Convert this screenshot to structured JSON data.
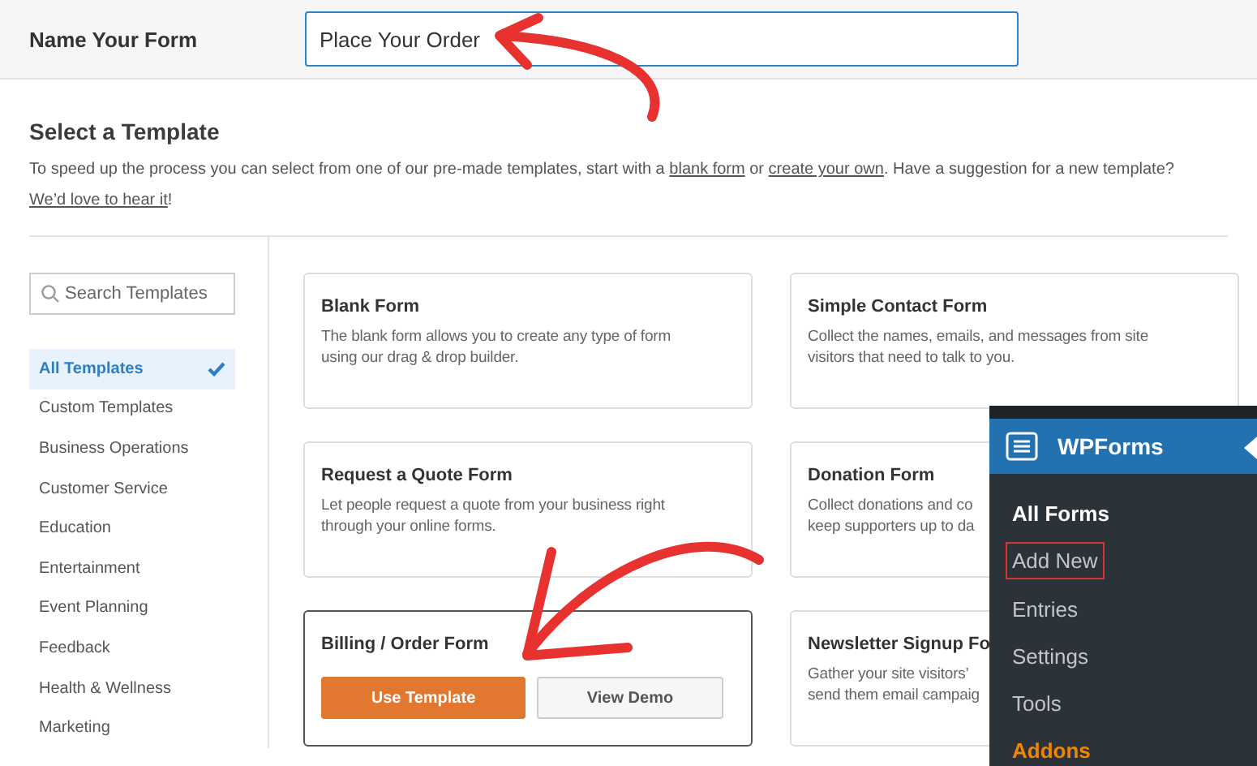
{
  "name_form": {
    "label": "Name Your Form",
    "value": "Place Your Order"
  },
  "section": {
    "title": "Select a Template",
    "intro": [
      {
        "kind": "text",
        "text": "To speed up the process you can select from one of our pre-made templates, start with a "
      },
      {
        "kind": "link",
        "text": "blank form"
      },
      {
        "kind": "text",
        "text": " or "
      },
      {
        "kind": "link",
        "text": "create your own"
      },
      {
        "kind": "text",
        "text": ". Have a suggestion for a new template? "
      },
      {
        "kind": "link",
        "text": "We’d love to hear it"
      },
      {
        "kind": "text",
        "text": "!"
      }
    ]
  },
  "search": {
    "placeholder": "Search Templates"
  },
  "categories": [
    {
      "label": "All Templates",
      "selected": true
    },
    {
      "label": "Custom Templates",
      "selected": false
    },
    {
      "label": "Business Operations",
      "selected": false
    },
    {
      "label": "Customer Service",
      "selected": false
    },
    {
      "label": "Education",
      "selected": false
    },
    {
      "label": "Entertainment",
      "selected": false
    },
    {
      "label": "Event Planning",
      "selected": false
    },
    {
      "label": "Feedback",
      "selected": false
    },
    {
      "label": "Health & Wellness",
      "selected": false
    },
    {
      "label": "Marketing",
      "selected": false
    }
  ],
  "templates": [
    {
      "title": "Blank Form",
      "description": [
        "The blank form allows you to create any type of form",
        "using our drag & drop builder."
      ],
      "selected": false
    },
    {
      "title": "Simple Contact Form",
      "description": [
        "Collect the names, emails, and messages from site",
        "visitors that need to talk to you."
      ],
      "selected": false
    },
    {
      "title": "Request a Quote Form",
      "description": [
        "Let people request a quote from your business right",
        "through your online forms."
      ],
      "selected": false
    },
    {
      "title": "Donation Form",
      "description": [
        "Collect donations and co",
        "keep supporters up to da"
      ],
      "selected": false
    },
    {
      "title": "Billing / Order Form",
      "selected": true,
      "buttons": [
        {
          "label": "Use Template",
          "kind": "primary"
        },
        {
          "label": "View Demo",
          "kind": "secondary"
        }
      ]
    },
    {
      "title": "Newsletter Signup Fo",
      "description": [
        "Gather your site visitors’",
        "send them email campaig"
      ],
      "selected": false
    }
  ],
  "wp_menu": {
    "title": "WPForms",
    "items": [
      {
        "label": "All Forms",
        "selected": true,
        "highlighted": false,
        "kind": "link"
      },
      {
        "label": "Add New",
        "selected": false,
        "highlighted": true,
        "kind": "link"
      },
      {
        "label": "Entries",
        "selected": false,
        "highlighted": false,
        "kind": "link"
      },
      {
        "label": "Settings",
        "selected": false,
        "highlighted": false,
        "kind": "link"
      },
      {
        "label": "Tools",
        "selected": false,
        "highlighted": false,
        "kind": "link"
      },
      {
        "label": "Addons",
        "selected": false,
        "highlighted": false,
        "kind": "addon"
      }
    ]
  }
}
